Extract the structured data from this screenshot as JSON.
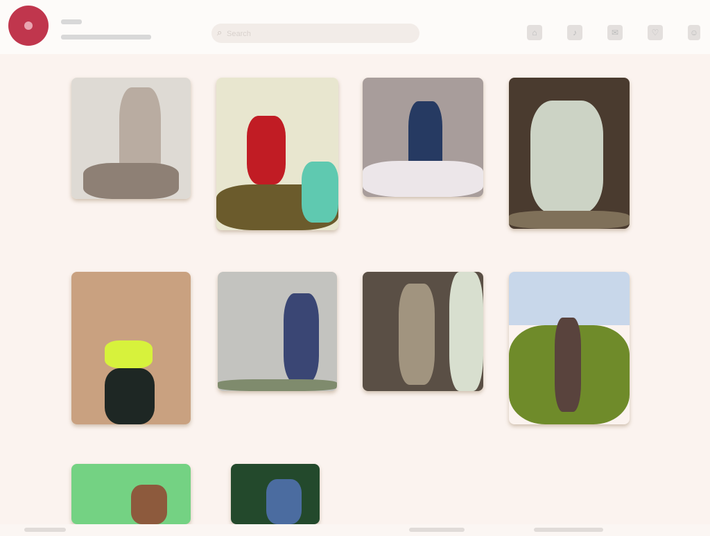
{
  "header": {
    "search_placeholder": "Search"
  },
  "nav_icons": [
    "home-icon",
    "bell-icon",
    "chat-icon",
    "heart-icon",
    "user-icon"
  ],
  "gallery": {
    "items": [
      {
        "name": "photo-1",
        "colors": [
          "#dedad4",
          "#b9aca1",
          "#8e8075"
        ]
      },
      {
        "name": "photo-2",
        "colors": [
          "#e8e6cf",
          "#c11c24",
          "#6b5b2c",
          "#5fc9b0"
        ]
      },
      {
        "name": "photo-3",
        "colors": [
          "#a89d9b",
          "#263a62",
          "#ece6e9"
        ]
      },
      {
        "name": "photo-4",
        "colors": [
          "#4a3b2f",
          "#ccd3c5",
          "#7f7059"
        ]
      },
      {
        "name": "photo-5",
        "colors": [
          "#c9a180",
          "#d7f23c",
          "#1e2724"
        ]
      },
      {
        "name": "photo-6",
        "colors": [
          "#c3c3bf",
          "#3a4674",
          "#7f8b6d"
        ]
      },
      {
        "name": "photo-7",
        "colors": [
          "#5a4f45",
          "#d8dfcf",
          "#a1947f"
        ]
      },
      {
        "name": "photo-8",
        "colors": [
          "#c8d7ea",
          "#6f8b2a",
          "#59433d"
        ]
      },
      {
        "name": "photo-9",
        "colors": [
          "#74d283",
          "#8d5a3d"
        ]
      },
      {
        "name": "photo-10",
        "colors": [
          "#23492c",
          "#4b6ca0"
        ]
      }
    ]
  }
}
